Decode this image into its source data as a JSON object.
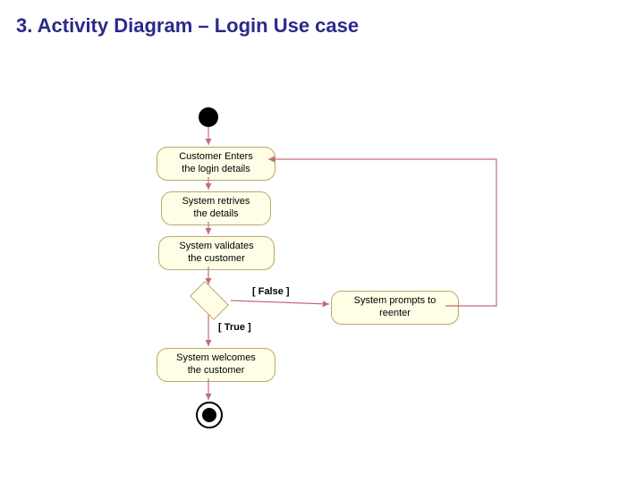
{
  "title": "3. Activity Diagram – Login Use case",
  "activities": {
    "a1": "Customer Enters\nthe login details",
    "a2": "System retrives\nthe details",
    "a3": "System validates\nthe customer",
    "a4": "System welcomes\nthe customer",
    "a5": "System prompts to\nreenter"
  },
  "guards": {
    "gFalse": "[ False ]",
    "gTrue": "[ True ]"
  },
  "chart_data": {
    "type": "activity-diagram",
    "title": "Login Use case",
    "nodes": [
      {
        "id": "start",
        "type": "initial"
      },
      {
        "id": "a1",
        "type": "activity",
        "label": "Customer Enters the login details"
      },
      {
        "id": "a2",
        "type": "activity",
        "label": "System retrives the details"
      },
      {
        "id": "a3",
        "type": "activity",
        "label": "System validates the customer"
      },
      {
        "id": "d1",
        "type": "decision"
      },
      {
        "id": "a4",
        "type": "activity",
        "label": "System welcomes the customer"
      },
      {
        "id": "a5",
        "type": "activity",
        "label": "System prompts to reenter"
      },
      {
        "id": "end",
        "type": "final"
      }
    ],
    "edges": [
      {
        "from": "start",
        "to": "a1"
      },
      {
        "from": "a1",
        "to": "a2"
      },
      {
        "from": "a2",
        "to": "a3"
      },
      {
        "from": "a3",
        "to": "d1"
      },
      {
        "from": "d1",
        "to": "a5",
        "guard": "[ False ]"
      },
      {
        "from": "d1",
        "to": "a4",
        "guard": "[ True ]"
      },
      {
        "from": "a5",
        "to": "a1"
      },
      {
        "from": "a4",
        "to": "end"
      }
    ]
  }
}
